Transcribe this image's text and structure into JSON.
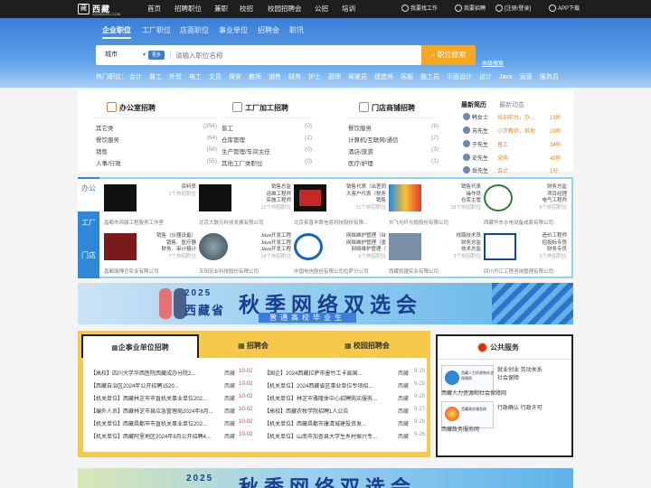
{
  "topbar": {
    "logo": "西藏",
    "logo_sub": "人才网",
    "logo_url": "XIZANGRC.COM",
    "nav": [
      "首页",
      "招聘职位",
      "兼职",
      "校招",
      "校园招聘会",
      "公招",
      "培训"
    ],
    "right": [
      "我要找工作",
      "我要招聘",
      "[注册/登录]",
      "APP下载"
    ]
  },
  "tabs": [
    "企业职位",
    "工厂职位",
    "店面职位",
    "事业单位",
    "招聘会",
    "职讯"
  ],
  "search": {
    "city": "城市",
    "more": "更多",
    "placeholder": "请输入职位名称",
    "button": "职位搜索",
    "advanced": "高级搜索"
  },
  "hot": {
    "label": "热门职位：",
    "items": [
      "会计",
      "普工",
      "外贸",
      "电工",
      "文员",
      "保安",
      "教师",
      "销售",
      "财务",
      "护士",
      "厨师",
      "驾驶员",
      "建造师",
      "客服",
      "施工员",
      "平面设计",
      "设计",
      "Java",
      "运营",
      "服务员"
    ]
  },
  "categories": [
    {
      "title": "办公室招聘",
      "rows": [
        [
          "其它类",
          "(354)"
        ],
        [
          "餐饮服务",
          "(64)"
        ],
        [
          "销售",
          "(58)"
        ],
        [
          "人事/行政",
          "(55)"
        ]
      ]
    },
    {
      "title": "工厂加工招聘",
      "rows": [
        [
          "普工",
          "(0)"
        ],
        [
          "仓库管理",
          "(1)"
        ],
        [
          "生产管理/车间主任",
          "(0)"
        ],
        [
          "其他工厂类职位",
          "(0)"
        ]
      ]
    },
    {
      "title": "门店商铺招聘",
      "rows": [
        [
          "餐饮服务",
          "(8)"
        ],
        [
          "计算机/互联网/通信",
          "(2)"
        ],
        [
          "酒店/旅游",
          "(3)"
        ],
        [
          "医疗/护理",
          "(1)"
        ]
      ]
    }
  ],
  "news": {
    "tabs": [
      "最新简历",
      "最新动态"
    ],
    "rows": [
      [
        "韩女士",
        "培训前台，办...",
        "19秒"
      ],
      [
        "苏先生",
        "小学教师，其他",
        "29秒"
      ],
      [
        "于先生",
        "普工",
        "34秒"
      ],
      [
        "史先生",
        "采购",
        "45秒"
      ],
      [
        "岳先生",
        "会计",
        "1分"
      ]
    ]
  },
  "company_side": [
    "办公",
    "工厂",
    "门店"
  ],
  "companies": [
    {
      "jobs": [
        "资料员"
      ],
      "count": "1个热招职位",
      "name": "昌都市鸿骏工程服务工作室"
    },
    {
      "jobs": [
        "销售总监",
        "运维工程师",
        "实施工程师"
      ],
      "count": "12个热招职位",
      "name": "北京大数元科技发展有限公司"
    },
    {
      "jobs": [
        "销售代表（出差同",
        "大客户代表（税务",
        "销售"
      ],
      "count": "31个热招职位",
      "name": "北京拓普丰联信息科技股份有限..."
    },
    {
      "jobs": [
        "销售代表",
        "操作员",
        "仓库主管"
      ],
      "count": "18个热招职位",
      "name": "长飞光纤光缆股份有限公司"
    },
    {
      "jobs": [
        "财务总监",
        "项目经理",
        "电气工程师"
      ],
      "count": "8个热招职位",
      "name": "西藏华东水电设备成套有限公司"
    },
    {
      "jobs": [
        "销售（仪器设备）",
        "销售、医疗器",
        "财务、审计稽计"
      ],
      "count": "7个热招职位",
      "name": "昌都瑞博仑实业有限公司"
    },
    {
      "jobs": [
        "Java开发工程",
        "Java开发工程",
        "Java开发工程"
      ],
      "count": "14个热招职位",
      "name": "天阳宏业科技股份有限公司"
    },
    {
      "jobs": [
        "网络维护管理（台",
        "网络维护管理（墨",
        "网络维护管理（"
      ],
      "count": "6个热招职位",
      "name": "中国电信股份有限公司拉萨分公司"
    },
    {
      "jobs": [
        "线路技术员",
        "财务总监",
        "技术总监"
      ],
      "count": "9个热招职位",
      "name": "西藏凯捷实业有限公司"
    },
    {
      "jobs": [
        "造价工程师",
        "招投标专员",
        "财务专员"
      ],
      "count": "3个热招职位",
      "name": "四川丹江工程咨询管理有限公司"
    }
  ],
  "ad": {
    "year": "2025",
    "t1": "西藏省",
    "t2": "秋季网络双选会",
    "t3": "普通高校毕业生"
  },
  "panel": {
    "tabs": [
      "企事业单位招聘",
      "招聘会",
      "校园招聘会"
    ],
    "left": [
      [
        "【高校】四川大学华西医院西藏成办分院2...",
        "西藏",
        "10-02"
      ],
      [
        "【西藏自治区2024年公开招聘1520...",
        "西藏",
        "10-02"
      ],
      [
        "【机关单位】西藏林芝市市直机关事业单位202...",
        "西藏",
        "10-02"
      ],
      [
        "【编外人员】西藏林芝市县应急管理局2024年8月...",
        "西藏",
        "10-02"
      ],
      [
        "【机关单位】西藏昌都市市直机关事业单位202...",
        "西藏",
        "10-02"
      ],
      [
        "【机关单位】西藏阿里地区2024年8月公开招聘4...",
        "西藏",
        "10-02"
      ]
    ],
    "right": [
      [
        "【国企】2024西藏拉萨市墨竹工卡县国...",
        "西藏",
        "9-29"
      ],
      [
        "【机关单位】2024西藏省区事业单位专项招...",
        "西藏",
        "9-29"
      ],
      [
        "【机关单位】林芝市雅隆体中心招聘购买服务...",
        "西藏",
        "9-28"
      ],
      [
        "【高校】西藏农牧学院招聘1人公告",
        "西藏",
        "9-27"
      ],
      [
        "【机关单位】西藏昌都市康清城建投资发...",
        "西藏",
        "9-26"
      ],
      [
        "【机关单位】山南市加查县大学生乡村振兴专...",
        "西藏",
        "9-26"
      ]
    ]
  },
  "public": {
    "title": "公共服务",
    "items": [
      {
        "img": "西藏人力资源和社会保障网",
        "links": [
          "就业创业",
          "劳动关系",
          "社会保障"
        ],
        "caption": "西藏人力资源和社会保障网"
      },
      {
        "img": "西藏政务服务网",
        "links": [
          "行政确认",
          "行政许可"
        ],
        "caption": "西藏政务服务网"
      }
    ]
  },
  "ad2": {
    "year": "2025",
    "t2": "秋季网络双选会"
  }
}
